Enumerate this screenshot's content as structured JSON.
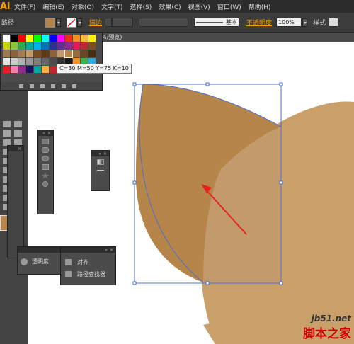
{
  "app_logo": "Ai",
  "menu": [
    "文件(F)",
    "编辑(E)",
    "对象(O)",
    "文字(T)",
    "选择(S)",
    "效果(C)",
    "视图(V)",
    "窗口(W)",
    "帮助(H)"
  ],
  "control": {
    "path_label": "路径",
    "stroke_label": "描边",
    "stroke_style": "基本",
    "opacity_label": "不透明度",
    "opacity_value": "100%",
    "style_label": "样式",
    "fill_color": "#b5854a"
  },
  "tab_label": "%/预览)",
  "swatches": {
    "colors": [
      "#ffffff",
      "#000000",
      "#ff0000",
      "#ffff00",
      "#00ff00",
      "#00ffff",
      "#0000ff",
      "#ff00ff",
      "#e63312",
      "#f28e1c",
      "#f6b83e",
      "#fef200",
      "#c9d400",
      "#8cc63e",
      "#33a853",
      "#00a99d",
      "#00aeef",
      "#0072bc",
      "#2e3192",
      "#662d91",
      "#92278f",
      "#ed145b",
      "#c1272d",
      "#7f4e21",
      "#9e7a52",
      "#8b6239",
      "#a67c52",
      "#c69c6d",
      "#754c24",
      "#603913",
      "#8c6239",
      "#c29a6b",
      "#b5854a",
      "#9a6b3a",
      "#6b4423",
      "#4a2e12",
      "#e6e6e6",
      "#cccccc",
      "#b3b3b3",
      "#999999",
      "#808080",
      "#666666",
      "#4d4d4d",
      "#333333",
      "#1a1a1a",
      "#f7931e",
      "#39b54a",
      "#29abe2",
      "#ed1c24",
      "#ff7bac",
      "#93278f",
      "#1b1464",
      "#00a79d",
      "#fbb03b",
      "#c1272d",
      "#d9e021",
      "#8cc63f",
      "#006837",
      "#0071bc",
      "#662d91"
    ],
    "tooltip": "C=30 M=50 Y=75 K=10"
  },
  "panels": {
    "transparency": "透明度",
    "align": "对齐",
    "pathfinder": "路径查找器"
  },
  "watermark": {
    "site": "jb51.net",
    "brand": "脚本之家"
  },
  "colors": {
    "shape_dark": "#b5854a",
    "shape_light": "#c9a06a",
    "selection": "#4a6fd1",
    "arrow": "#e8201e"
  }
}
